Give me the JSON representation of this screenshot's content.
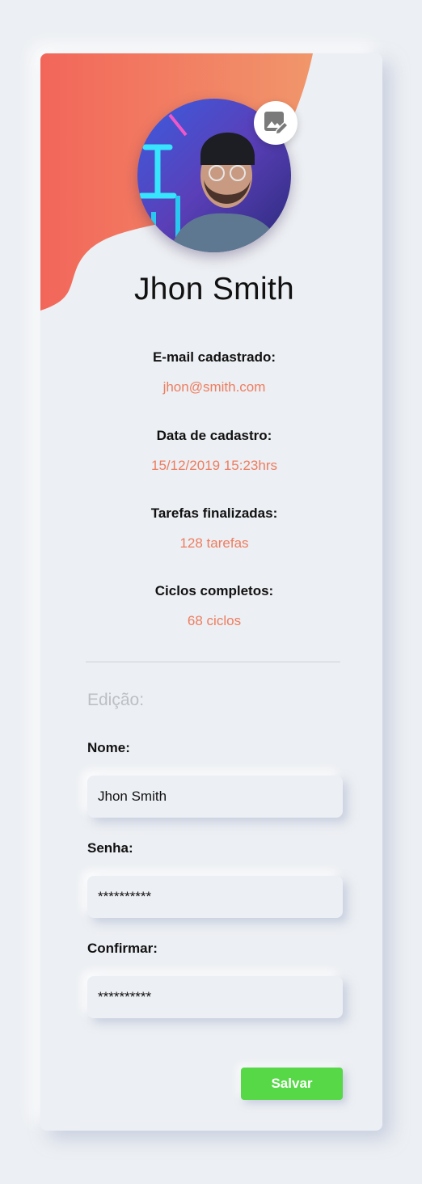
{
  "colors": {
    "background": "#eceff3",
    "accent_gradient_start": "#f2665a",
    "accent_gradient_end": "#f1966b",
    "value_text": "#ee7d60",
    "save_button": "#56d847"
  },
  "profile": {
    "name": "Jhon Smith",
    "edit_photo_icon": "image-edit-icon"
  },
  "info": [
    {
      "label": "E-mail cadastrado:",
      "value": "jhon@smith.com"
    },
    {
      "label": "Data de cadastro:",
      "value": "15/12/2019 15:23hrs"
    },
    {
      "label": "Tarefas finalizadas:",
      "value": "128 tarefas"
    },
    {
      "label": "Ciclos completos:",
      "value": "68 ciclos"
    }
  ],
  "edit": {
    "title": "Edição:",
    "name_label": "Nome:",
    "name_value": "Jhon Smith",
    "password_label": "Senha:",
    "password_value": "**********",
    "confirm_label": "Confirmar:",
    "confirm_value": "**********",
    "save_label": "Salvar"
  }
}
